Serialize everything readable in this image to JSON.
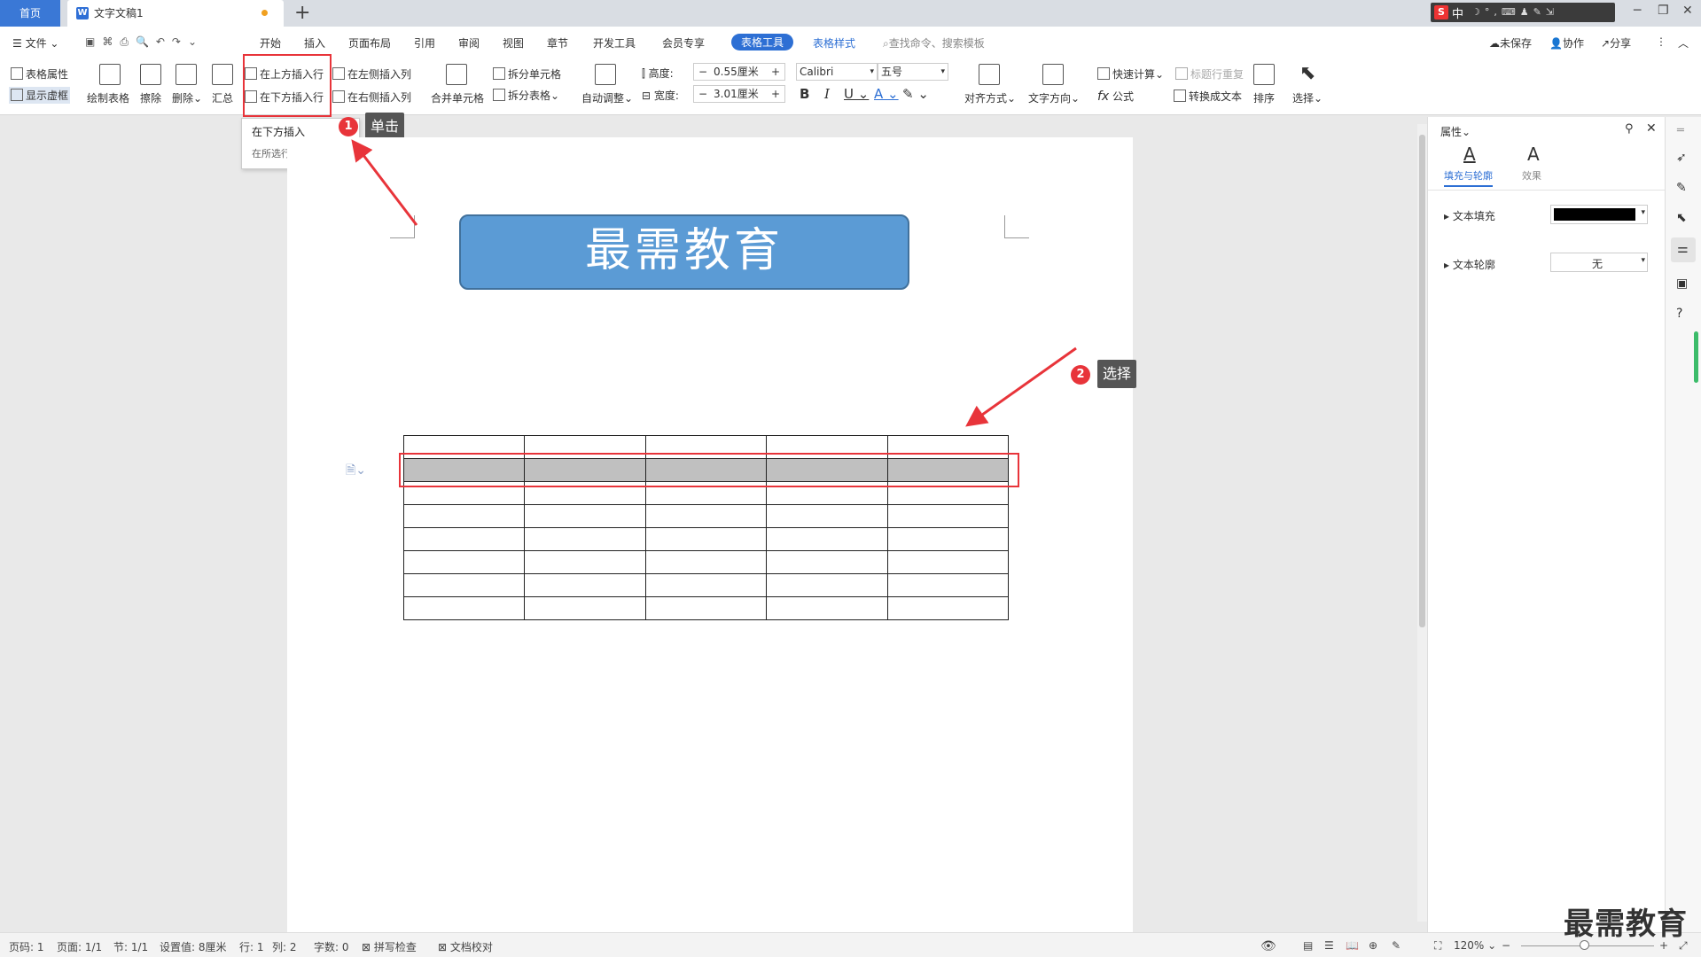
{
  "tabs": {
    "home": "首页",
    "doc": "文字文稿1"
  },
  "ime": {
    "zh": "中"
  },
  "menu": {
    "file": "文件",
    "items": [
      "开始",
      "插入",
      "页面布局",
      "引用",
      "审阅",
      "视图",
      "章节",
      "开发工具",
      "会员专享"
    ],
    "active": "表格工具",
    "table_style": "表格样式",
    "search_placeholder": "查找命令、搜索模板",
    "unsaved": "未保存",
    "collab": "协作",
    "share": "分享"
  },
  "ribbon": {
    "table_props": "表格属性",
    "show_grid": "显示虚框",
    "draw_table": "绘制表格",
    "erase": "擦除",
    "delete": "删除",
    "summary": "汇总",
    "insert_above": "在上方插入行",
    "insert_below": "在下方插入行",
    "insert_left": "在左侧插入列",
    "insert_right": "在右侧插入列",
    "merge": "合并单元格",
    "split_cell": "拆分单元格",
    "split_table": "拆分表格",
    "auto_adjust": "自动调整",
    "height_label": "高度:",
    "height_value": "0.55厘米",
    "width_label": "宽度:",
    "width_value": "3.01厘米",
    "font": "Calibri",
    "font_size": "五号",
    "align": "对齐方式",
    "text_dir": "文字方向",
    "quick_calc": "快速计算",
    "header_repeat": "标题行重复",
    "formula": "公式",
    "to_text": "转换成文本",
    "sort": "排序",
    "select": "选择"
  },
  "tooltip": {
    "title": "在下方插入",
    "desc": "在所选行下方插入行"
  },
  "steps": [
    {
      "num": "1",
      "label": "单击"
    },
    {
      "num": "2",
      "label": "选择"
    }
  ],
  "document": {
    "banner": "最需教育",
    "rows": 8,
    "cols": 5,
    "selected_row": 1
  },
  "panel": {
    "title": "属性",
    "tab_fill": "填充与轮廓",
    "tab_effect": "效果",
    "text_fill": "文本填充",
    "text_outline": "文本轮廓",
    "outline_value": "无",
    "fill_color": "#000000"
  },
  "status": {
    "page_num": "页码: 1",
    "page": "页面: 1/1",
    "section": "节: 1/1",
    "setting": "设置值: 8厘米",
    "row": "行: 1",
    "col": "列: 2",
    "words": "字数: 0",
    "spell": "拼写检查",
    "proof": "文档校对",
    "zoom": "120%"
  },
  "watermark": "最需教育",
  "colors": {
    "accent": "#2d6fd4",
    "annotation": "#e8343a",
    "banner": "#5b9bd5"
  }
}
